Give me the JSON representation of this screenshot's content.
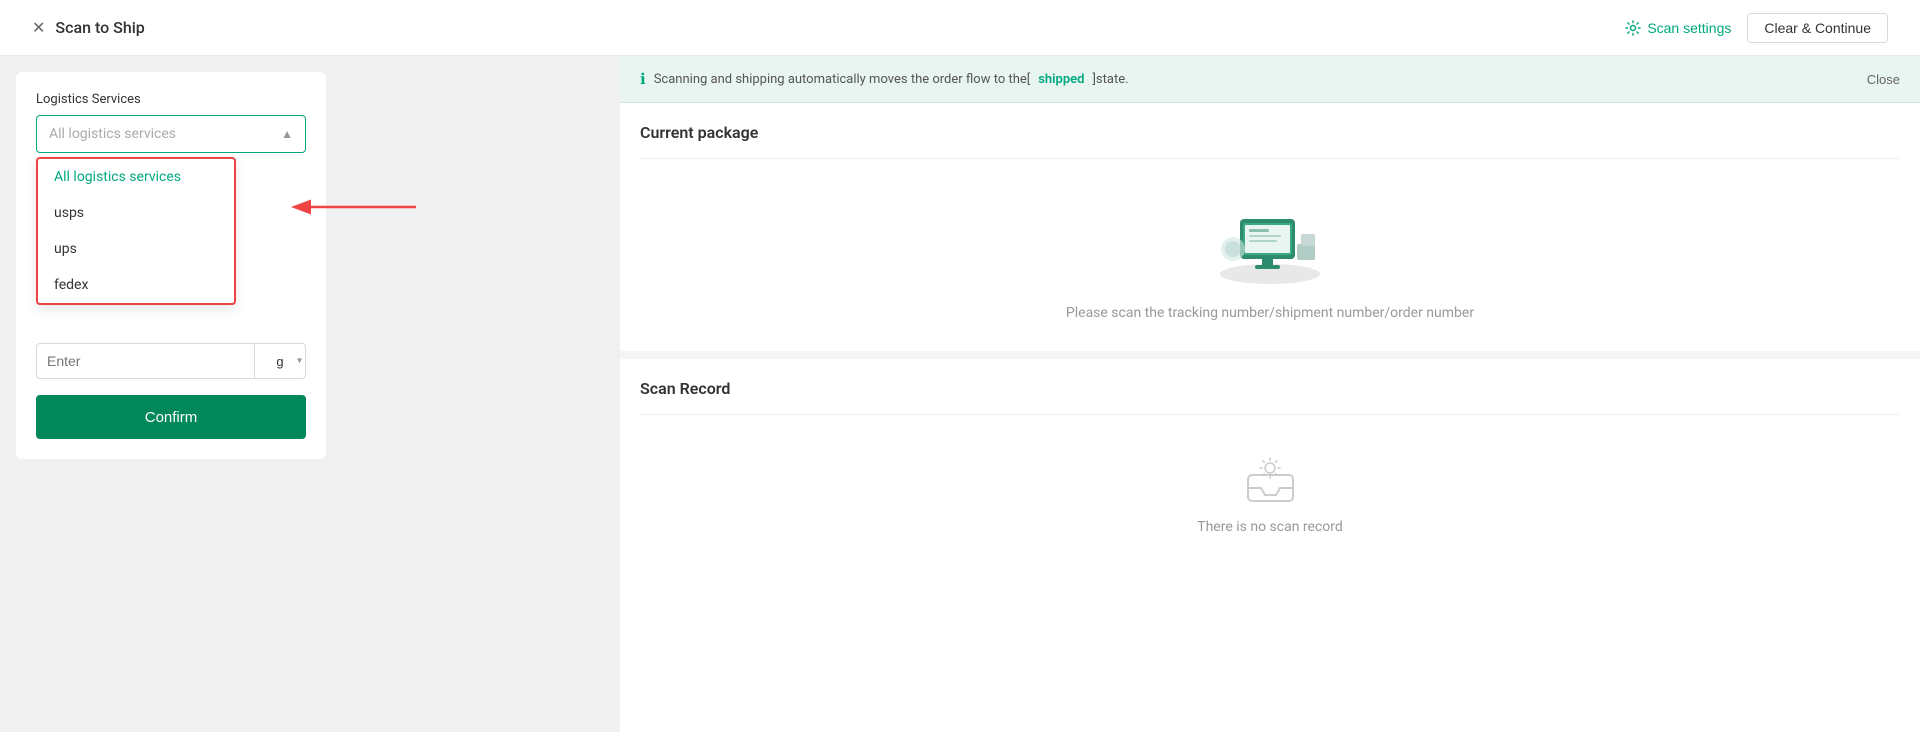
{
  "header": {
    "close_icon": "✕",
    "title": "Scan to Ship",
    "scan_settings_label": "Scan settings",
    "clear_continue_label": "Clear & Continue"
  },
  "banner": {
    "message_prefix": "Scanning and shipping automatically moves the order flow to the[",
    "shipped_label": "shipped",
    "message_suffix": "]state.",
    "close_label": "Close"
  },
  "left_panel": {
    "logistics_label": "Logistics Services",
    "select_placeholder": "All logistics services",
    "dropdown_items": [
      {
        "label": "All logistics services",
        "active": true
      },
      {
        "label": "usps",
        "active": false
      },
      {
        "label": "ups",
        "active": false
      },
      {
        "label": "fedex",
        "active": false
      }
    ],
    "weight_placeholder": "Enter",
    "weight_unit": "g",
    "confirm_label": "Confirm"
  },
  "current_package": {
    "title": "Current package",
    "empty_text": "Please scan the tracking number/shipment number/order number"
  },
  "scan_record": {
    "title": "Scan Record",
    "empty_text": "There is no scan record"
  }
}
